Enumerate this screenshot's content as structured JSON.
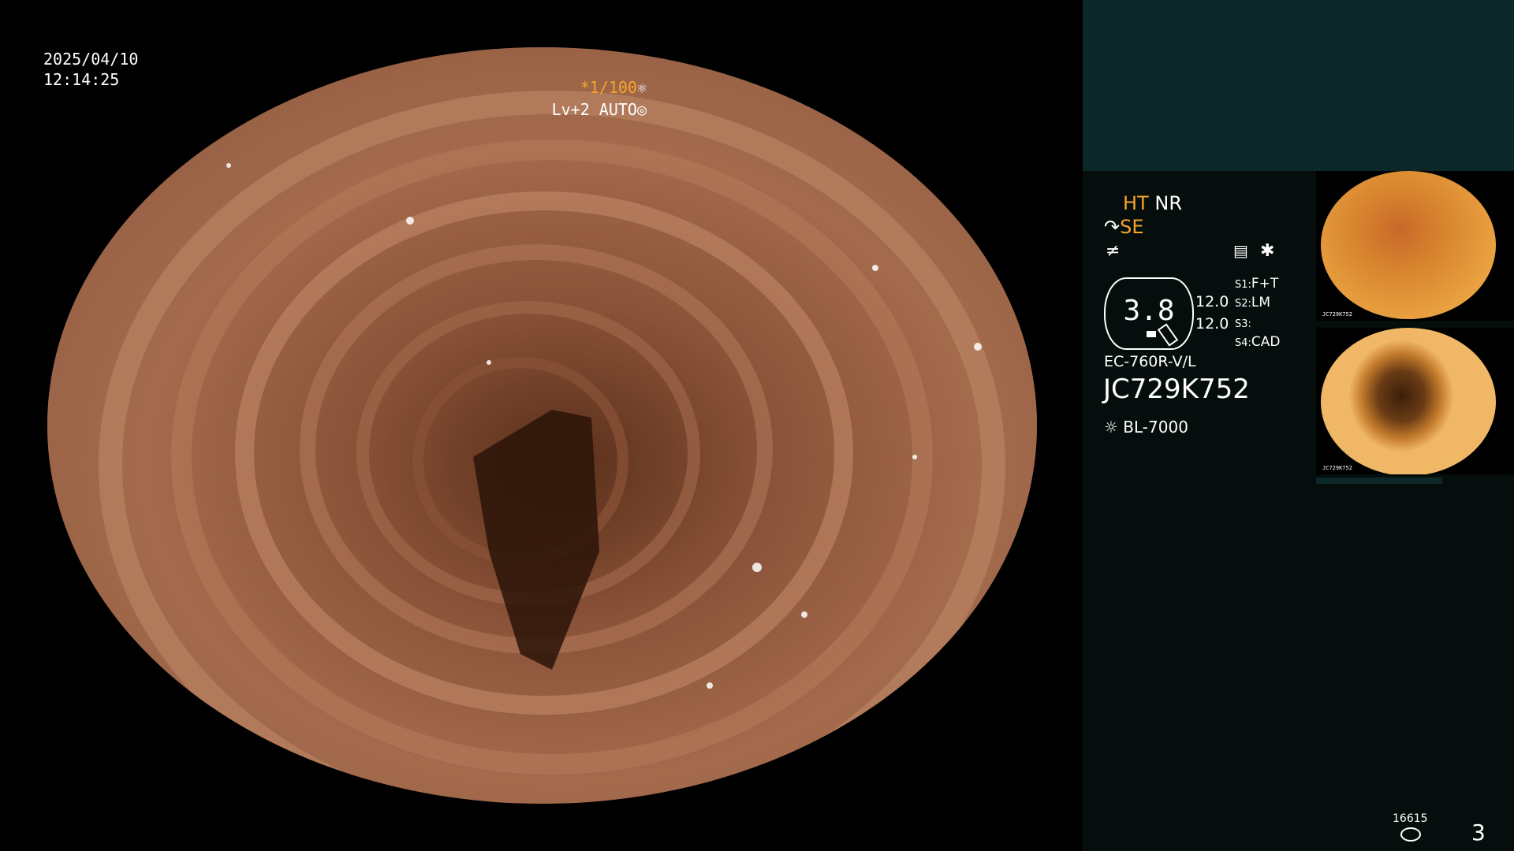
{
  "osd": {
    "date": "2025/04/10",
    "time": "12:14:25",
    "shutter": "*1/100",
    "shutter_icon": "aperture-icon",
    "level": "Lv+2 AUTO",
    "level_icon": "iris-icon"
  },
  "panel": {
    "ht": "HT",
    "nr": "NR",
    "se": "SE",
    "ht_nr_se_colors": {
      "ht": "#f4a52b",
      "nr": "#ffffff",
      "se": "#f4a52b"
    },
    "mode_icons": [
      "scope-mode-icon",
      "freeze-icon",
      "settings-icon",
      "star-icon"
    ],
    "enhance_value": "3.8",
    "enhance_a": "12.0",
    "enhance_b": "12.0",
    "s1_label": "S1:",
    "s1_value": "F+T",
    "s2_label": "S2:",
    "s2_value": "LM",
    "s3_label": "S3:",
    "s3_value": "",
    "s4_label": "S4:",
    "s4_value": "CAD",
    "scope_model": "EC-760R-V/L",
    "serial": "JC729K752",
    "light_source": "BL-7000",
    "light_icon": "sun-icon"
  },
  "thumbnails": [
    {
      "caption": "JC729K752"
    },
    {
      "caption": "JC729K752"
    }
  ],
  "footer": {
    "count": "16615",
    "count_icon": "storage-icon",
    "page": "3"
  },
  "colors": {
    "accent": "#f4a52b",
    "panel_bg": "#050d0d",
    "panel_top_bg": "#0c2727"
  }
}
